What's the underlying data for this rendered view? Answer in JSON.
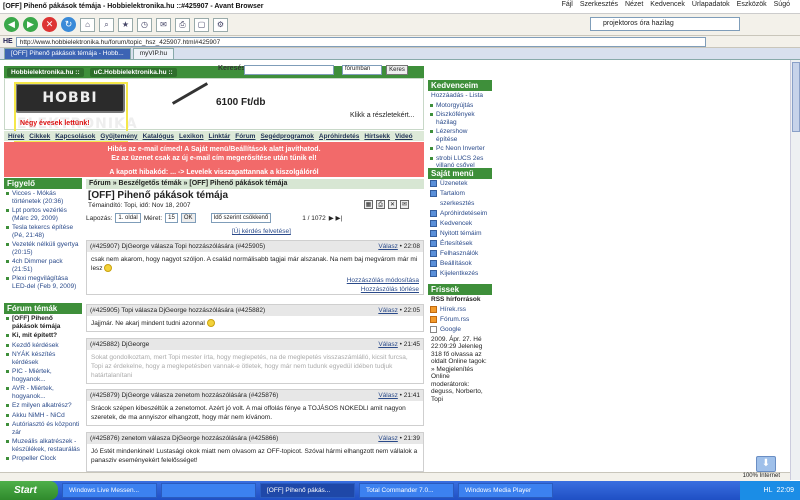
{
  "window": {
    "title": "[OFF] Pihenő pákások témája - Hobbielektronika.hu ::#425907 - Avant Browser",
    "menu": [
      "Fájl",
      "Szerkesztés",
      "Nézet",
      "Kedvencek",
      "Úrlapadatok",
      "Eszközök",
      "Súgó"
    ]
  },
  "toolbar": {
    "search_value": "projektoros óra hazilag"
  },
  "address": {
    "label": "HE",
    "url": "http://www.hobbielektronika.hu/forum/topic_hsz_425907.html#425907"
  },
  "browser_tabs": [
    {
      "label": "[OFF] Pihenő pákások témája - Hobb...",
      "active": true
    },
    {
      "label": "myVIP.hu",
      "active": false
    }
  ],
  "site": {
    "tabs": [
      "Hobbielektronika.hu ::",
      "uC.Hobbielektronika.hu ::"
    ],
    "search_label": "Keresés:",
    "search_scope": "fórumban",
    "search_button": "Keres",
    "logo_text": "HOBBI ELEKTRONIKA",
    "anniversary": "Négy évesek lettünk!",
    "price": "6100 Ft/db",
    "klikk": "Klikk a részletekért...",
    "nav": [
      "Hírek",
      "Cikkek",
      "Kapcsolások",
      "Gyűjtemény",
      "Katalógus",
      "Lexikon",
      "Linktár",
      "Fórum",
      "Segédprogramok",
      "Apróhirdetés",
      "Hírtsekk",
      "Videó"
    ],
    "alert_lines": [
      "Hibás az e-mail címed! A Saját menü/Beállítások alatt javíthatod.",
      "Ez az üzenet csak az új e-mail cím megerősítése után tűnik el!",
      "A kapott hibakód: ... -> Levelek visszapattannak a kiszolgálóról"
    ]
  },
  "left_sidebar": {
    "figyelo_title": "Figyelő",
    "figyelo_items": [
      "Vicces - Mókás történetek (20:36)",
      "Lpt portos vezérlés (Márc 29, 2009)",
      "Tesla tekercs építése (Pé, 21:48)",
      "Vezeték nélküli gyertya (20:15)",
      "4ch Dimmer pack (21:51)",
      "Plexi megvilágítása LED-del (Feb 9, 2009)"
    ],
    "forum_title": "Fórum témák",
    "forum_items": [
      "[OFF] Pihenő pákások témája",
      "Ki, mit épített?",
      "Kezdő kérdések",
      "NYÁK készítés kérdések",
      "PIC - Miértek, hogyanok...",
      "AVR - Miértek, hogyanok...",
      "Ez milyen alkatrész?",
      "Akku NiMH - NiCd",
      "Autóriasztó és központi zár",
      "Muzeális alkatrészek - készülékek, restaurálás",
      "Propeller Clock"
    ]
  },
  "main": {
    "breadcrumb": "Fórum » Beszélgetős témák » [OFF] Pihenő pákások témája",
    "title": "[OFF] Pihenő pákások témája",
    "meta": "Témaindító: Topi, idő: Nov 18, 2007",
    "lapozas_label": "Lapozás:",
    "page_select": "1. oldal",
    "meret_label": "Méret:",
    "meret_value": "15",
    "ok": "OK",
    "order": "Idő szerint csökkenő",
    "counter": "1 / 1072",
    "new_question": "[Új kérdés felvetése]",
    "posts": [
      {
        "head": "(#425907) DjGeorge válasza Topi hozzászólására (#425905)",
        "time": "22:08",
        "reply": "Válasz",
        "body": "csak nem akarom, hogy nagyot szóljon. A család normálisabb tagjai már alszanak. Na nem baj megvárom már mi lesz",
        "links": [
          "Hozzászólás módosítása",
          "Hozzászólás törlése"
        ]
      },
      {
        "head": "(#425905) Topi válasza DjGeorge hozzászólására (#425882)",
        "time": "22:05",
        "reply": "Válasz",
        "body": "Jajjmár. Ne akarj mindent tudni azonnal"
      },
      {
        "head": "(#425882) DjGeorge",
        "time": "21:45",
        "reply": "Válasz",
        "body": "Sokat gondolkoztam, mert Topi mester írta, hogy meglepetés, na de meglepetés visszaszámlálló, kicsit furcsa, Topi az érdekelne, hogy a meglepetésben vannak-e ötletek, hogy már nem tudunk egyedül idében tudjuk határtalanítani"
      },
      {
        "head": "(#425879) DjGeorge válasza zenetom hozzászólására (#425876)",
        "time": "21:41",
        "reply": "Válasz",
        "body": "Srácok szépen kibeszéltük a zenetomot. Azért jó volt. A mai offolás fénye a TOJÁSOS NOKEDLI amit nagyon szeretek, de ma annyiszor elhangzott, hogy már nem kívánom."
      },
      {
        "head": "(#425876) zenetom válasza DjGeorge hozzászólására (#425866)",
        "time": "21:39",
        "reply": "Válasz",
        "body": "Jó Estét mindenkinek! Lustasági okok miatt nem olvasom az OFF-topicot. Szóval hármi elhangzott nem vállalok a panasziv eseményekért felelősséget!"
      }
    ]
  },
  "right_sidebar": {
    "kedvencek_title": "Kedvenceim",
    "kedvencek_link": "Hozzáadás - Lista",
    "kedvencek_items": [
      "Motorgyújtás",
      "Diszkófények házilag",
      "Lézershow építése",
      "Pc Neon Inverter",
      "strobi LUCS 2es villanó csővel"
    ],
    "sajat_title": "Saját menü",
    "sajat_items": [
      "Üzenetek",
      "Tartalom szerkesztés",
      "Apróhirdetéseim",
      "Kedvencek",
      "Nyitott témáim",
      "Értesítések",
      "Felhasználók",
      "Beállítások",
      "Kijelentkezés"
    ],
    "frissek_title": "Frissek",
    "rss_title": "RSS hírforrások",
    "rss_items": [
      "Hírek.rss",
      "Fórum.rss",
      "Google"
    ],
    "info": "2009. Ápr. 27. Hé 22:09:29 Jelenleg 318 fő olvassa az oldalt Online tagok: » Megjelenítés Online moderátorok: deguss, Norberto, Topi"
  },
  "taskbar": {
    "start": "Start",
    "tasks": [
      "Windows Live Messen...",
      "",
      "[OFF] Pihenő pákás...",
      "Total Commander 7.0...",
      "Windows Media Player"
    ],
    "clock": "22:09",
    "lang": "HL"
  },
  "statusbar": {
    "zoom": "100%",
    "zone": "Internet"
  },
  "colors": {
    "site_green": "#3e8f3a",
    "alert_red": "#f26a6a",
    "link_blue": "#2a4a8a"
  }
}
